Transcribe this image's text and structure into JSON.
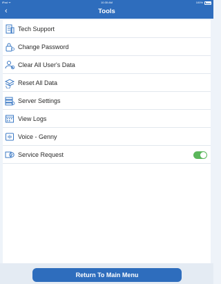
{
  "status_bar": {
    "carrier": "iPad ᯤ",
    "time": "10:35 AM",
    "battery": "100%"
  },
  "nav": {
    "back_glyph": "‹",
    "title": "Tools"
  },
  "tools": {
    "items": [
      {
        "label": "Tech Support",
        "icon": "document-clipboard-icon"
      },
      {
        "label": "Change Password",
        "icon": "lock-icon"
      },
      {
        "label": "Clear All User's Data",
        "icon": "user-clear-icon"
      },
      {
        "label": "Reset All Data",
        "icon": "reset-data-icon"
      },
      {
        "label": "Server Settings",
        "icon": "server-settings-icon"
      },
      {
        "label": "View Logs",
        "icon": "calendar-logs-icon"
      },
      {
        "label": "Voice - Genny",
        "icon": "voice-icon"
      },
      {
        "label": "Service Request",
        "icon": "service-request-icon",
        "toggle_on": true
      }
    ]
  },
  "footer": {
    "main_menu_label": "Return To Main Menu"
  },
  "colors": {
    "accent": "#2e6dbd",
    "toggle_on": "#5bb75b",
    "icon": "#3a78c4"
  }
}
